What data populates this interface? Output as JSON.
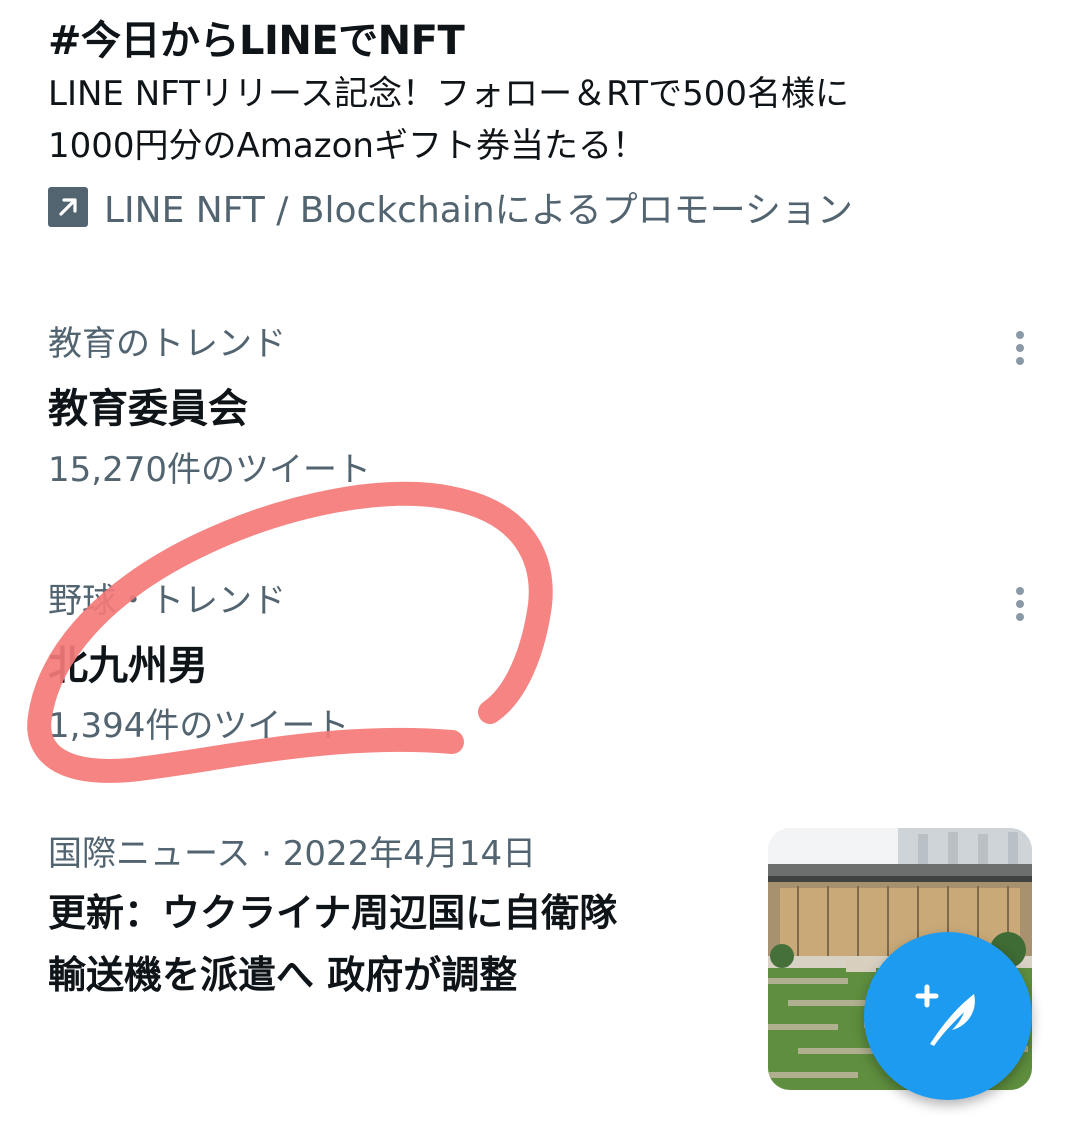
{
  "promoted": {
    "title": "#今日からLINEでNFT",
    "description_lines": [
      "LINE NFTリリース記念！フォロー＆RTで500名様に",
      "1000円分のAmazonギフト券当たる！"
    ],
    "promoted_by": "LINE NFT / Blockchainによるプロモーション",
    "icon": "external-link-arrow-icon"
  },
  "trends": [
    {
      "category": "教育のトレンド",
      "name": "教育委員会",
      "tweet_count": "15,270件のツイート",
      "more_icon": "vertical-ellipsis-icon"
    },
    {
      "category": "野球・トレンド",
      "name": "北九州男",
      "tweet_count": "1,394件のツイート",
      "more_icon": "vertical-ellipsis-icon"
    }
  ],
  "news": {
    "category": "国際ニュース",
    "separator": " · ",
    "date": "2022年4月14日",
    "headline_lines": [
      "更新：ウクライナ周辺国に自衛隊",
      "輸送機を派遣へ 政府が調整"
    ]
  },
  "compose_button": {
    "icon": "compose-tweet-feather-plus-icon",
    "color": "#1d9bf0"
  },
  "annotation": {
    "color": "#f47a78"
  }
}
